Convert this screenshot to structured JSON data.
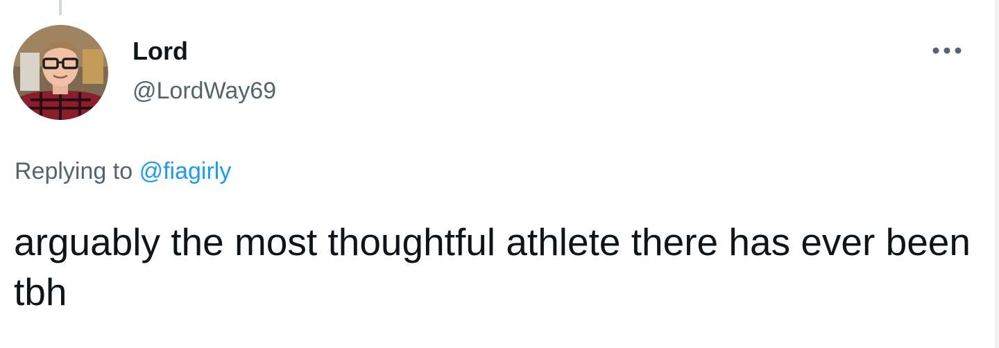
{
  "tweet": {
    "author": {
      "display_name": "Lord",
      "handle": "@LordWay69",
      "avatar_icon": "profile-photo"
    },
    "reply": {
      "prefix": "Replying to",
      "mention": "@fiagirly"
    },
    "text": "arguably the most thoughtful athlete there has ever been tbh",
    "more_icon": "more-horizontal-icon"
  },
  "colors": {
    "text_primary": "#0f1419",
    "text_secondary": "#536471",
    "link": "#1d9bf0",
    "thread_line": "#cfd9de"
  }
}
